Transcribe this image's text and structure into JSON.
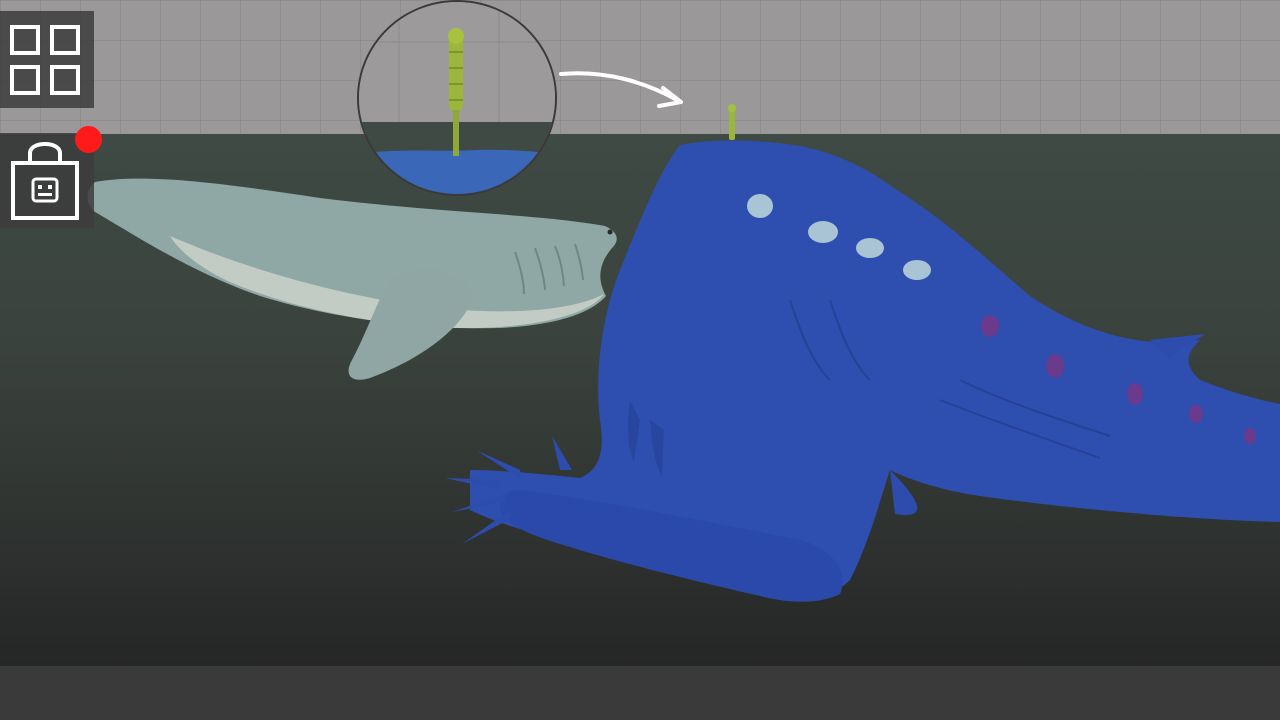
{
  "scene": {
    "wall_color": "#9a9898",
    "water_color": "#3d4741",
    "floor_color": "#3a3a3a"
  },
  "toolbar": {
    "menu_icon": "grid-four-squares-icon",
    "shop_icon": "shopping-bag-icon",
    "notification_color": "#ff1a1a",
    "icon_color": "#ffffff"
  },
  "entities": {
    "whale": {
      "name": "whale",
      "color": "#8fa8a6"
    },
    "sea_monster": {
      "name": "blue-sea-monster",
      "color": "#2f4fb0"
    },
    "ragdoll": {
      "name": "melon-ragdoll",
      "color": "#9bb63a"
    }
  },
  "zoom_lens": {
    "water_color": "#3b67b8"
  }
}
